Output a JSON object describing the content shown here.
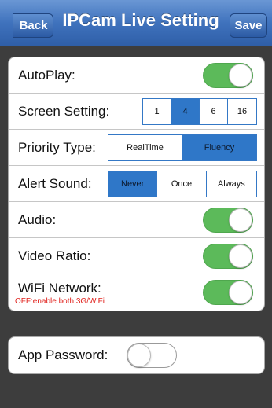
{
  "navbar": {
    "back_label": "Back",
    "title": "IPCam Live Setting",
    "save_label": "Save"
  },
  "settings": {
    "autoplay": {
      "label": "AutoPlay:",
      "on": true
    },
    "screen_setting": {
      "label": "Screen Setting:",
      "options": [
        "1",
        "4",
        "6",
        "16"
      ],
      "selected": "4"
    },
    "priority_type": {
      "label": "Priority Type:",
      "options": [
        "RealTime",
        "Fluency"
      ],
      "selected": "Fluency"
    },
    "alert_sound": {
      "label": "Alert Sound:",
      "options": [
        "Never",
        "Once",
        "Always"
      ],
      "selected": "Never"
    },
    "audio": {
      "label": "Audio:",
      "on": true
    },
    "video_ratio": {
      "label": "Video Ratio:",
      "on": true
    },
    "wifi_network": {
      "label": "WiFi Network:",
      "note": "OFF:enable both 3G/WiFi",
      "on": true
    }
  },
  "security": {
    "app_password": {
      "label": "App Password:",
      "on": false
    }
  },
  "colors": {
    "accent": "#2f77c8",
    "toggle_on": "#5cba5a",
    "note_red": "#e0201b"
  }
}
